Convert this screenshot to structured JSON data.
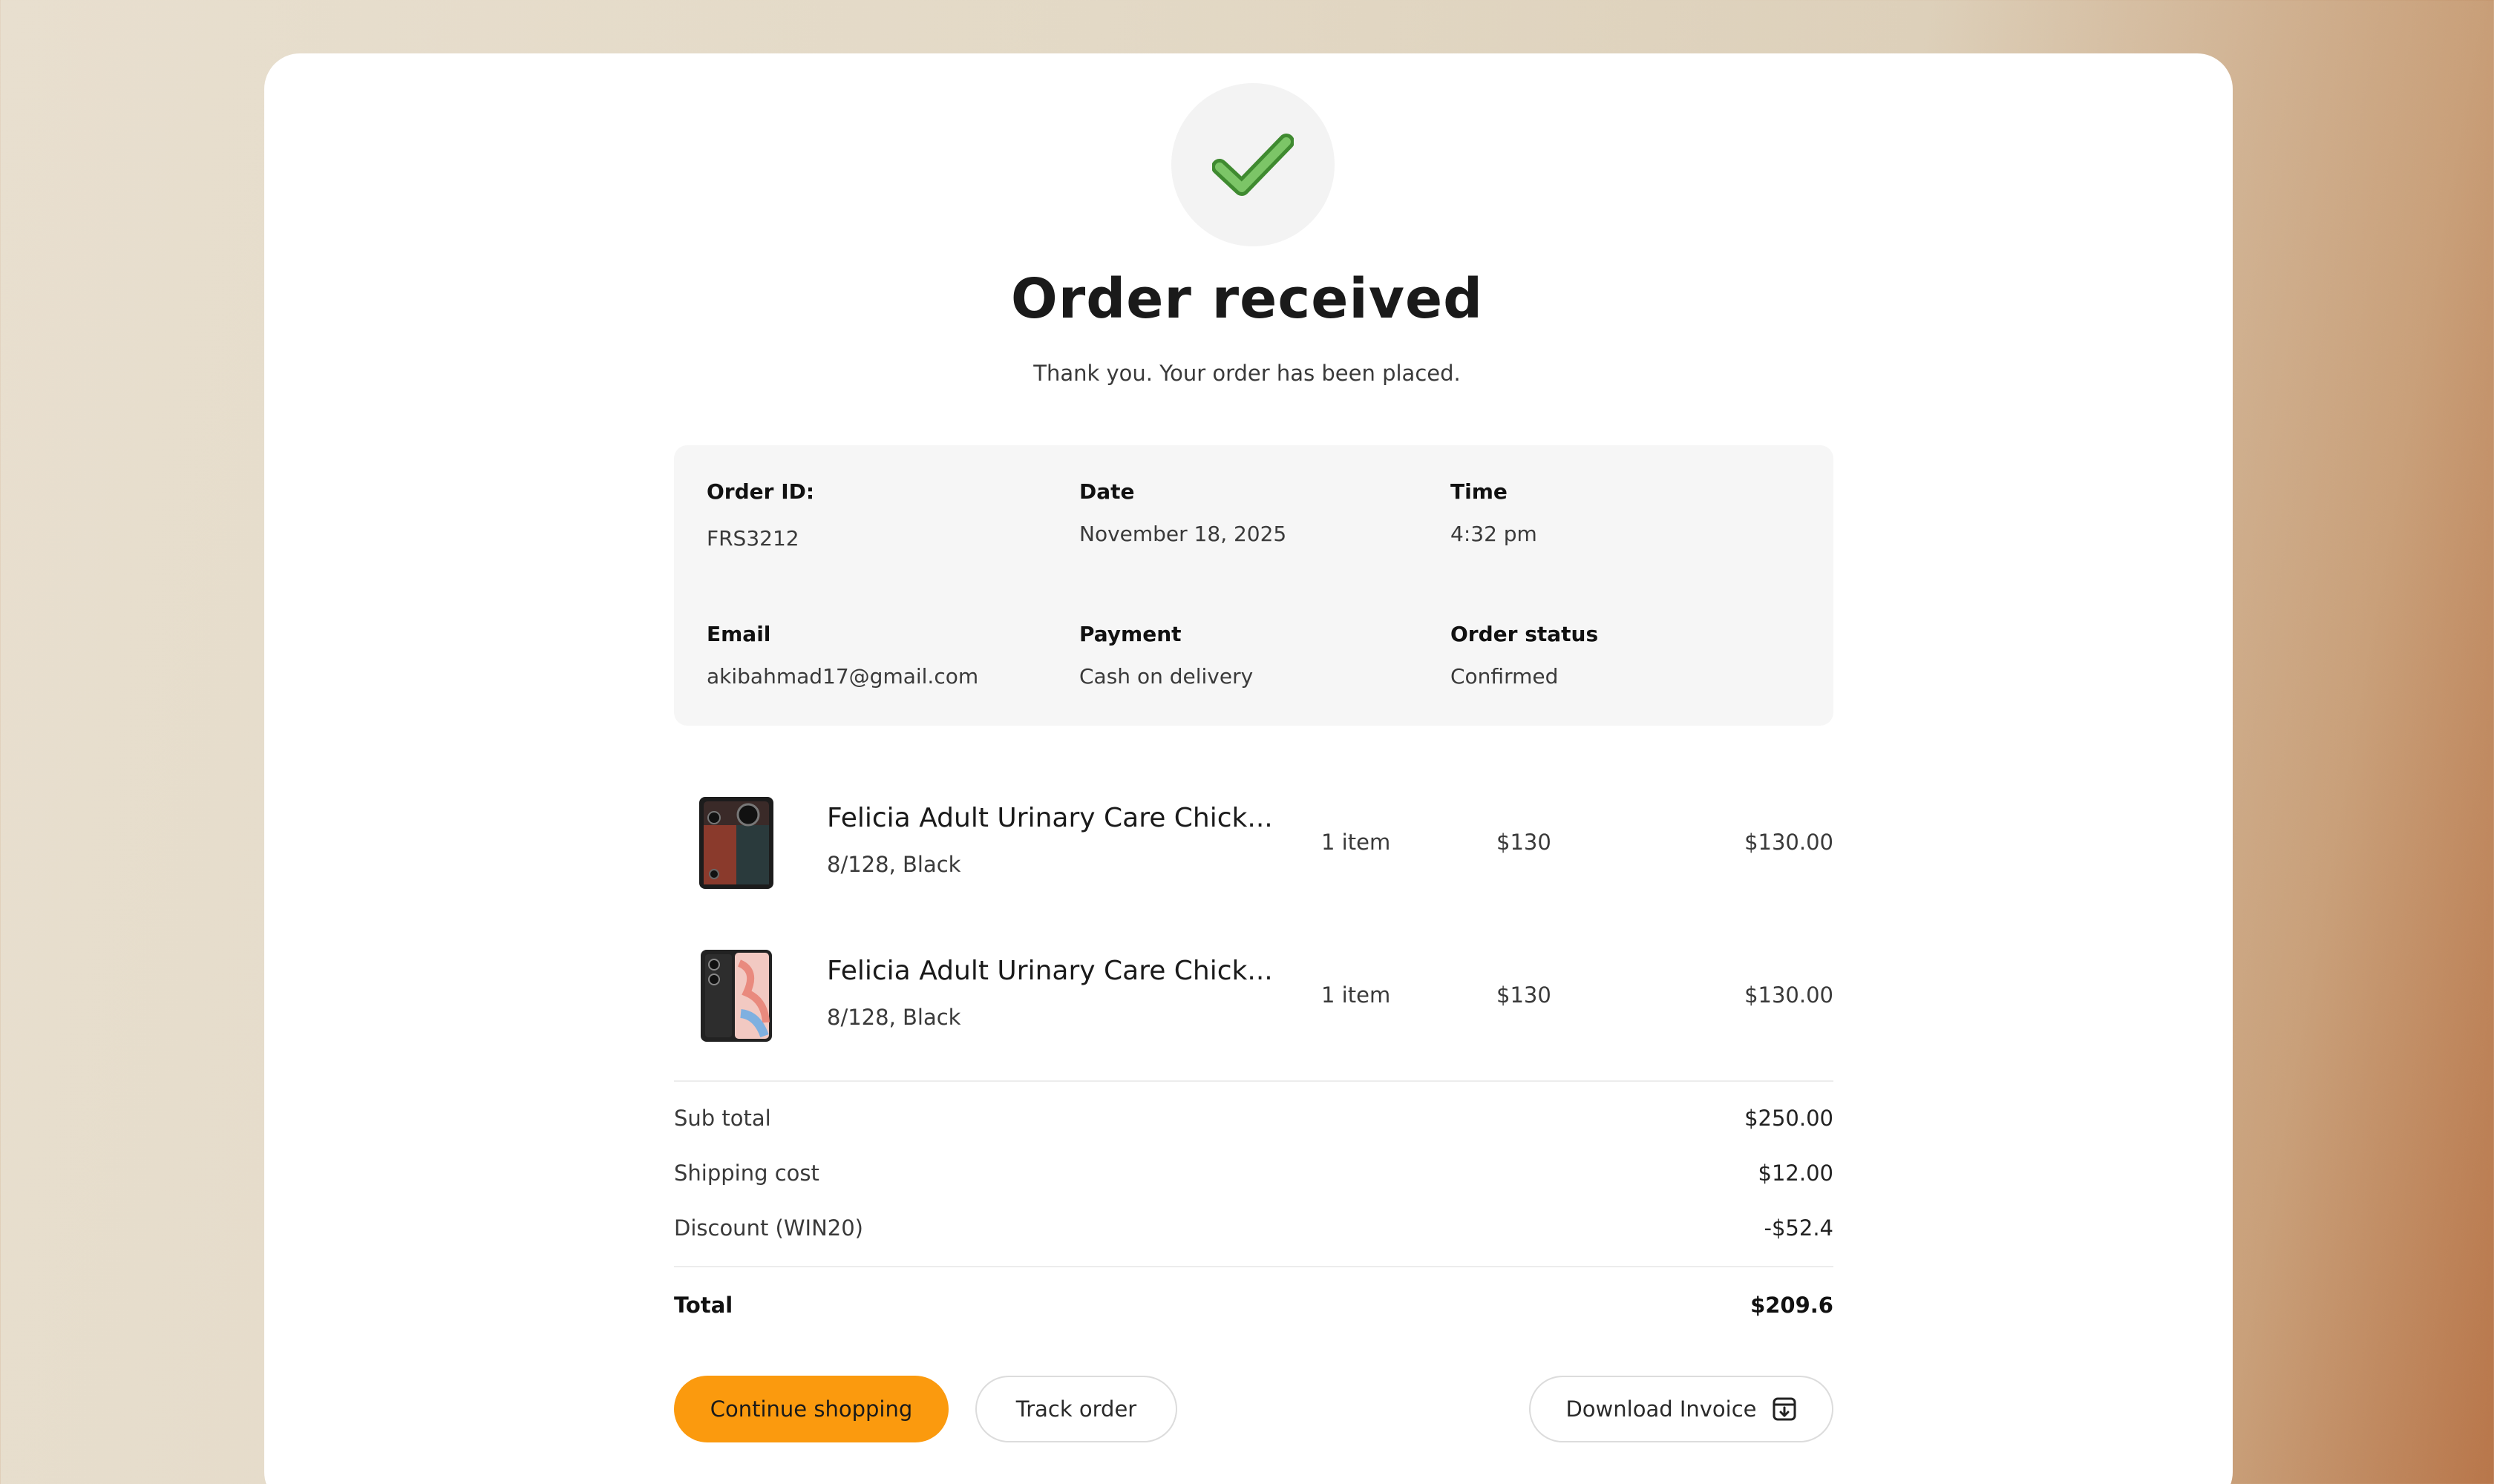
{
  "header": {
    "title": "Order received",
    "subtitle": "Thank you. Your order has been placed."
  },
  "order_info": {
    "order_id_label": "Order ID:",
    "order_id": "FRS3212",
    "date_label": "Date",
    "date": "November 18, 2025",
    "time_label": "Time",
    "time": "4:32 pm",
    "email_label": "Email",
    "email": "akibahmad17@gmail.com",
    "payment_label": "Payment",
    "payment": "Cash on delivery",
    "status_label": "Order status",
    "status": "Confirmed"
  },
  "items": [
    {
      "name": "Felicia Adult Urinary Care Chick...",
      "variant": "8/128, Black",
      "qty": "1 item",
      "price": "$130",
      "total": "$130.00"
    },
    {
      "name": "Felicia Adult Urinary Care Chick...",
      "variant": "8/128, Black",
      "qty": "1 item",
      "price": "$130",
      "total": "$130.00"
    }
  ],
  "summary": {
    "subtotal_label": "Sub total",
    "subtotal": "$250.00",
    "shipping_label": "Shipping cost",
    "shipping": "$12.00",
    "discount_label": "Discount (WIN20)",
    "discount": "-$52.4",
    "total_label": "Total",
    "total": "$209.6"
  },
  "actions": {
    "continue_label": "Continue shopping",
    "track_label": "Track order",
    "invoice_label": "Download Invoice"
  },
  "colors": {
    "accent": "#fb9a0e",
    "success": "#5aa846"
  },
  "icons": {
    "success": "check-icon",
    "invoice": "download-icon"
  }
}
